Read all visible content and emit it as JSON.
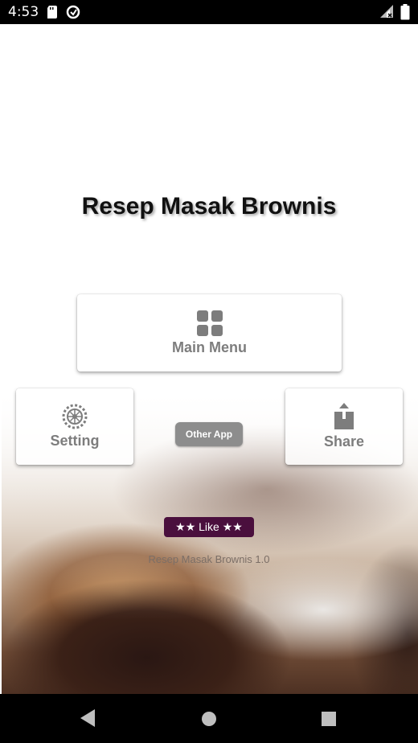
{
  "status_bar": {
    "time": "4:53",
    "icons": [
      "sd-card-icon",
      "sync-icon",
      "signal-icon",
      "battery-icon"
    ]
  },
  "app": {
    "title": "Resep Masak Brownis",
    "version_text": "Resep Masak Brownis 1.0"
  },
  "buttons": {
    "main_menu": "Main Menu",
    "setting": "Setting",
    "share": "Share",
    "other_app": "Other App",
    "like": "★★ Like ★★"
  },
  "navigation": {
    "back": "back-icon",
    "home": "home-icon",
    "recents": "recents-icon"
  },
  "colors": {
    "like_bg": "#4a0f3d",
    "other_app_bg": "#8d8d8d",
    "card_text": "#7d7d7d"
  }
}
